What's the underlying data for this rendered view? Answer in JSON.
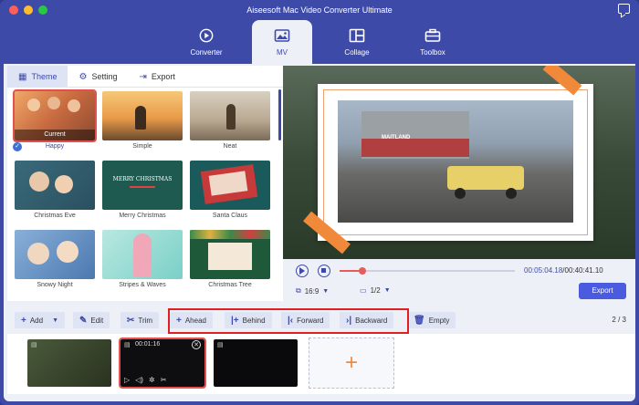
{
  "window": {
    "title": "Aiseesoft Mac Video Converter Ultimate"
  },
  "colors": {
    "accent": "#3d4aa8",
    "highlight": "#e02020",
    "export": "#4a5be0"
  },
  "nav": {
    "tabs": [
      {
        "label": "Converter",
        "icon": "converter-icon"
      },
      {
        "label": "MV",
        "icon": "mv-icon",
        "active": true
      },
      {
        "label": "Collage",
        "icon": "collage-icon"
      },
      {
        "label": "Toolbox",
        "icon": "toolbox-icon"
      }
    ]
  },
  "subtabs": [
    {
      "label": "Theme",
      "icon": "theme-icon",
      "active": true
    },
    {
      "label": "Setting",
      "icon": "gear-icon"
    },
    {
      "label": "Export",
      "icon": "export-icon"
    }
  ],
  "themes": [
    {
      "label": "Happy",
      "badge": "Current",
      "selected": true
    },
    {
      "label": "Simple"
    },
    {
      "label": "Neat"
    },
    {
      "label": "Christmas Eve"
    },
    {
      "label": "Merry Christmas"
    },
    {
      "label": "Santa Claus"
    },
    {
      "label": "Snowy Night"
    },
    {
      "label": "Stripes & Waves"
    },
    {
      "label": "Christmas Tree"
    }
  ],
  "preview": {
    "merry_text": "MERRY CHRISTMAS",
    "sign_text": "MAITLAND"
  },
  "player": {
    "current_time": "00:05:04.18",
    "total_time": "/00:40:41.10",
    "progress_fraction": 0.13,
    "aspect": "16:9",
    "screen": "1/2",
    "export_label": "Export"
  },
  "toolbar": {
    "add": "Add",
    "edit": "Edit",
    "trim": "Trim",
    "ahead": "Ahead",
    "behind": "Behind",
    "forward": "Forward",
    "backward": "Backward",
    "empty": "Empty",
    "page": "2 / 3"
  },
  "timeline": {
    "selected_clip_duration": "00:01:16"
  }
}
